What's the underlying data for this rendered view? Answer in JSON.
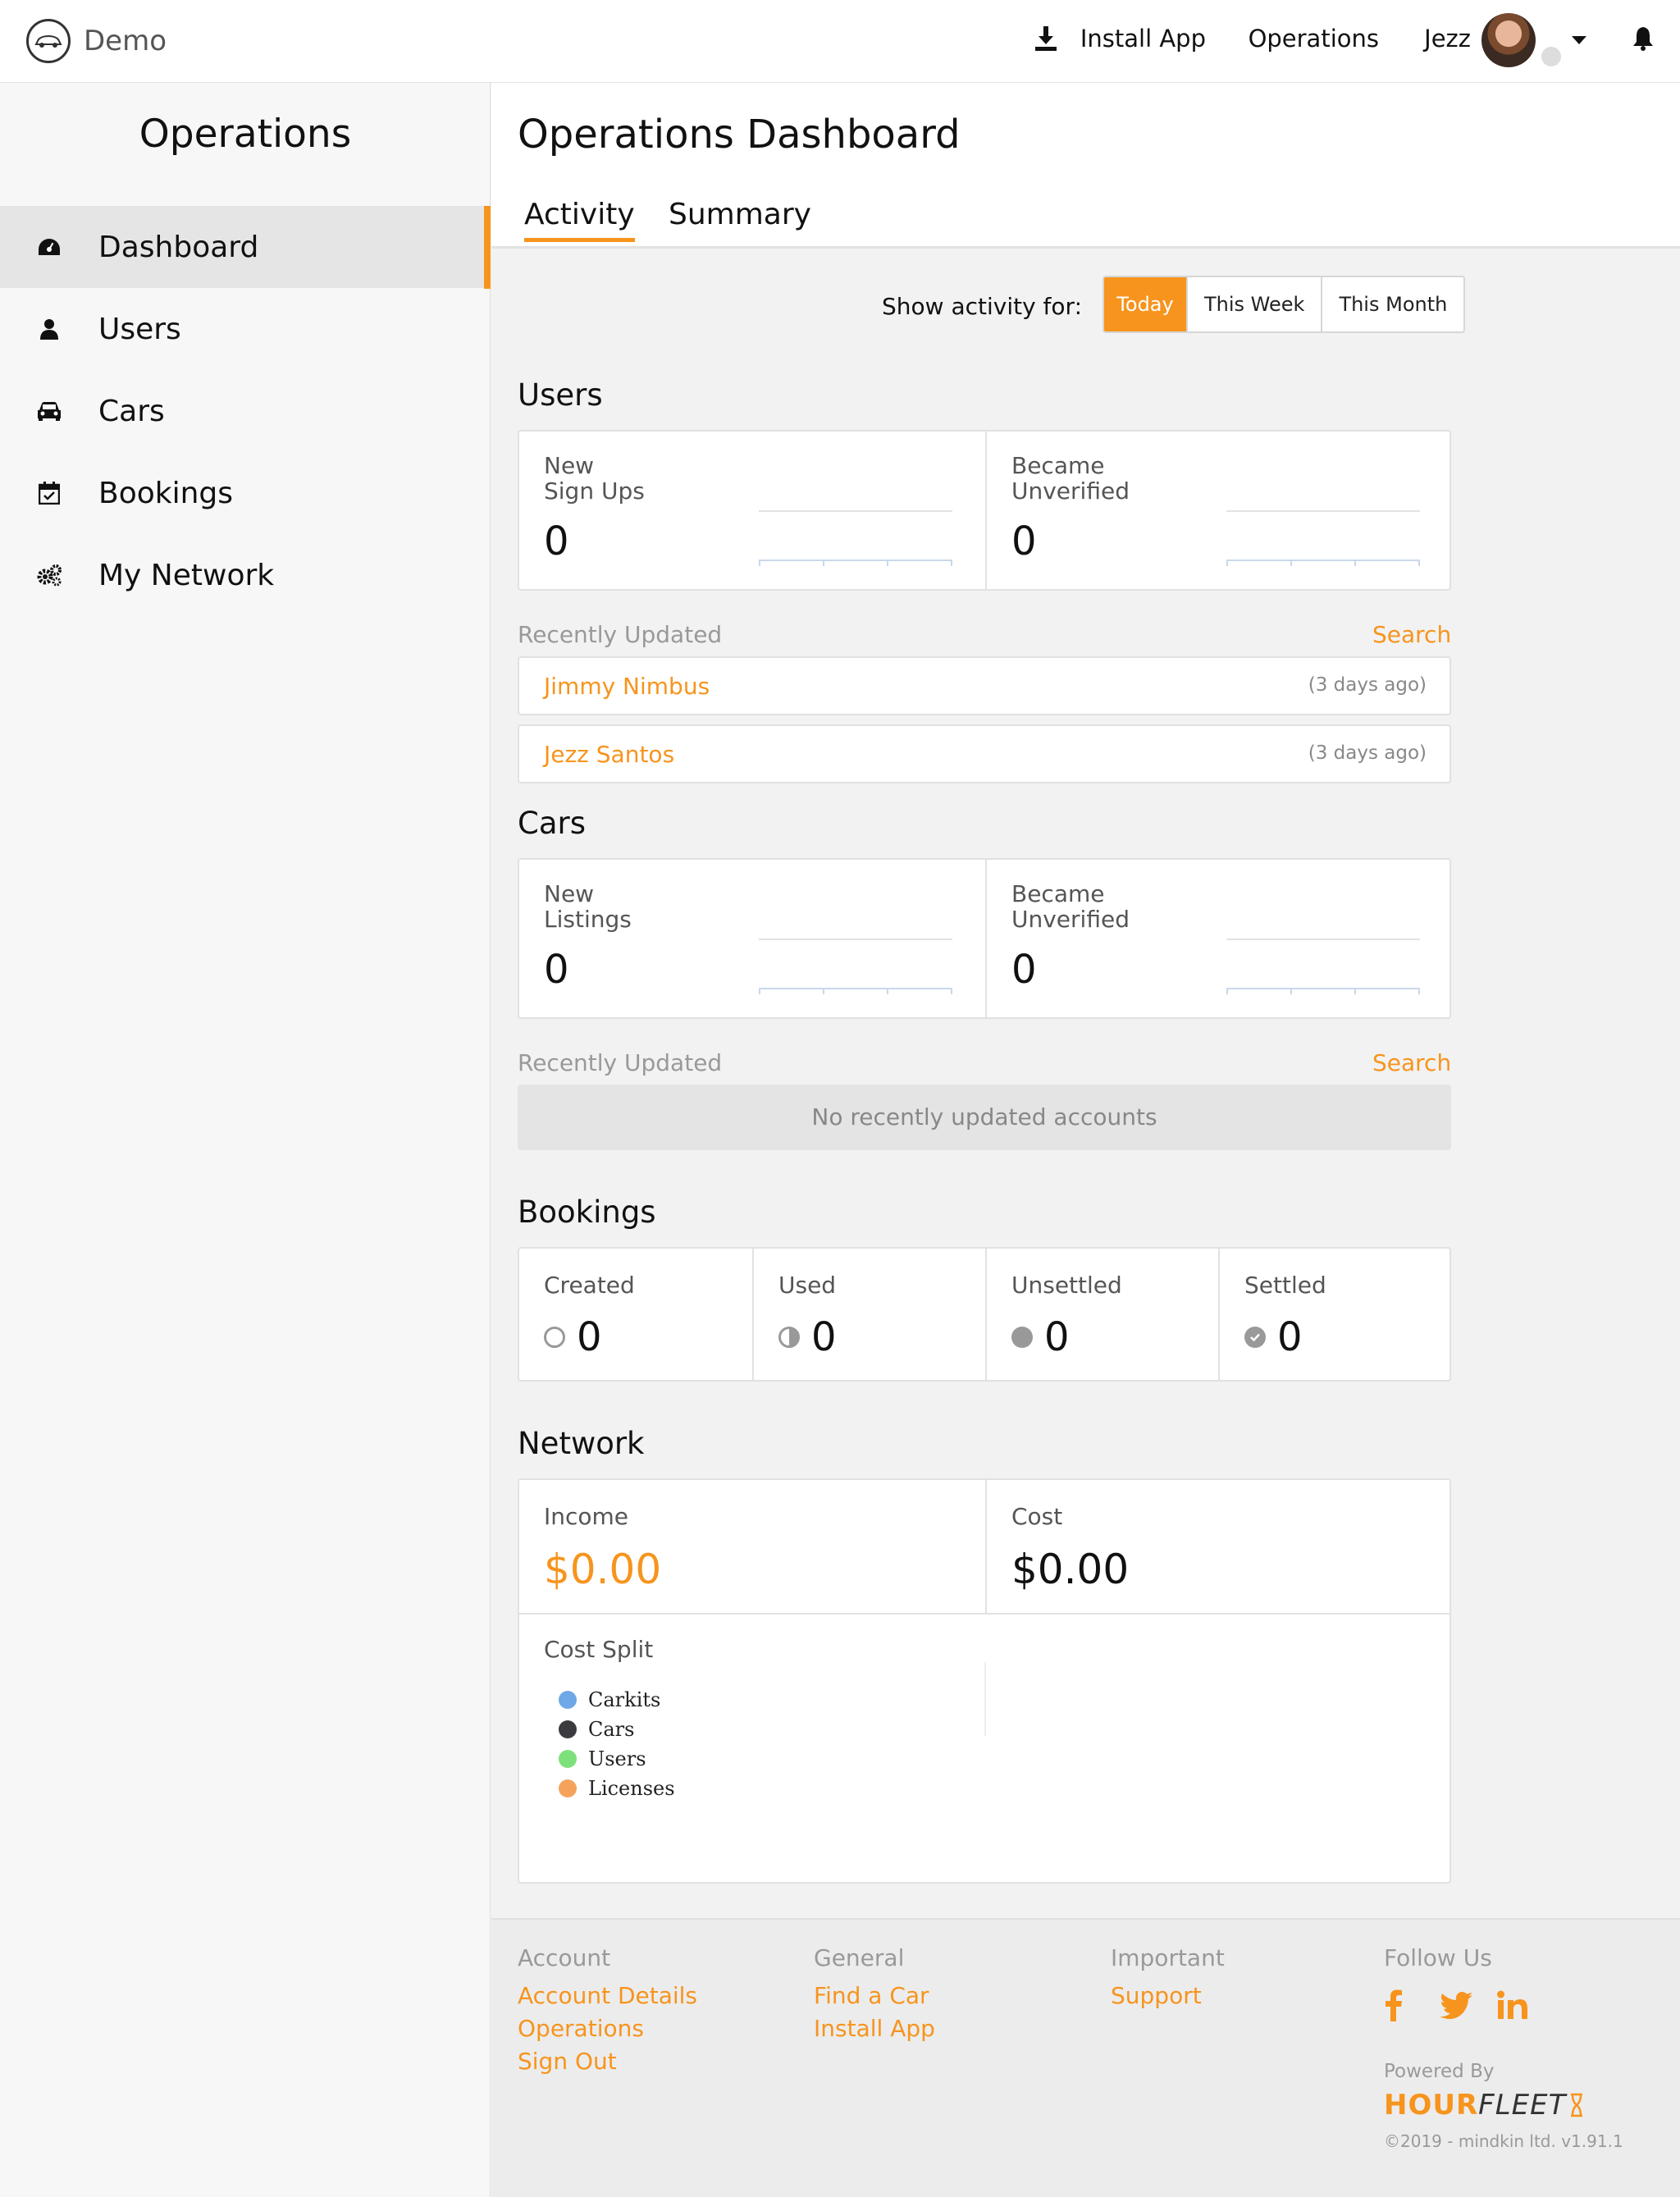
{
  "app": {
    "name": "Demo"
  },
  "topnav": {
    "install_label": "Install App",
    "operations_label": "Operations",
    "user_name": "Jezz"
  },
  "sidebar": {
    "title": "Operations",
    "items": [
      {
        "label": "Dashboard",
        "icon": "dashboard-icon"
      },
      {
        "label": "Users",
        "icon": "user-icon"
      },
      {
        "label": "Cars",
        "icon": "car-icon"
      },
      {
        "label": "Bookings",
        "icon": "calendar-check-icon"
      },
      {
        "label": "My Network",
        "icon": "gears-icon"
      }
    ]
  },
  "main": {
    "title": "Operations Dashboard",
    "tabs": [
      "Activity",
      "Summary"
    ],
    "filter": {
      "label": "Show activity for:",
      "options": [
        "Today",
        "This Week",
        "This Month"
      ],
      "selected": "Today"
    }
  },
  "users": {
    "heading": "Users",
    "stats": [
      {
        "label_line1": "New",
        "label_line2": "Sign Ups",
        "value": "0"
      },
      {
        "label_line1": "Became",
        "label_line2": "Unverified",
        "value": "0"
      }
    ],
    "recent_heading": "Recently Updated",
    "search_label": "Search",
    "recent": [
      {
        "name": "Jimmy Nimbus",
        "time": "(3 days ago)"
      },
      {
        "name": "Jezz Santos",
        "time": "(3 days ago)"
      }
    ]
  },
  "cars": {
    "heading": "Cars",
    "stats": [
      {
        "label_line1": "New",
        "label_line2": "Listings",
        "value": "0"
      },
      {
        "label_line1": "Became",
        "label_line2": "Unverified",
        "value": "0"
      }
    ],
    "recent_heading": "Recently Updated",
    "search_label": "Search",
    "empty_text": "No recently updated accounts"
  },
  "bookings": {
    "heading": "Bookings",
    "stats": [
      {
        "label": "Created",
        "value": "0"
      },
      {
        "label": "Used",
        "value": "0"
      },
      {
        "label": "Unsettled",
        "value": "0"
      },
      {
        "label": "Settled",
        "value": "0"
      }
    ]
  },
  "network": {
    "heading": "Network",
    "income_label": "Income",
    "income_value": "$0.00",
    "cost_label": "Cost",
    "cost_value": "$0.00",
    "split_label": "Cost Split",
    "legend": [
      {
        "label": "Carkits",
        "color": "#6ea8e6"
      },
      {
        "label": "Cars",
        "color": "#3a3a3f"
      },
      {
        "label": "Users",
        "color": "#7ee07a"
      },
      {
        "label": "Licenses",
        "color": "#f5a35c"
      }
    ]
  },
  "colors": {
    "accent": "#f7941d"
  },
  "footer": {
    "account": {
      "heading": "Account",
      "links": [
        "Account Details",
        "Operations",
        "Sign Out"
      ]
    },
    "general": {
      "heading": "General",
      "links": [
        "Find a Car",
        "Install App"
      ]
    },
    "important": {
      "heading": "Important",
      "links": [
        "Support"
      ]
    },
    "follow": {
      "heading": "Follow Us",
      "icons": [
        "facebook-icon",
        "twitter-icon",
        "linkedin-icon"
      ]
    },
    "powered_by": "Powered By",
    "brand_hour": "HOUR",
    "brand_fleet": "FLEET",
    "copyright": "©2019 - mindkin ltd. v1.91.1"
  }
}
